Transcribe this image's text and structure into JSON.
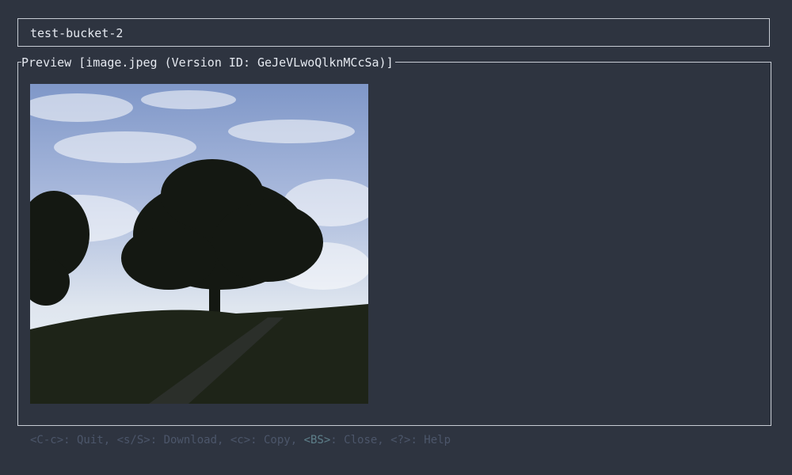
{
  "bucket": {
    "name": "test-bucket-2"
  },
  "preview": {
    "title": "Preview [image.jpeg (Version ID: GeJeVLwoQlknMCcSa)]"
  },
  "footer": {
    "parts": [
      "<C-c>: Quit, <s/S>: Download, <c>: Copy, ",
      "<BS>",
      ": Close, <?>: Help"
    ]
  },
  "colors": {
    "background": "#2e3440",
    "border": "#c7ccd4",
    "footer_text": "#4c566a",
    "footer_highlight": "#5e7f8a"
  }
}
